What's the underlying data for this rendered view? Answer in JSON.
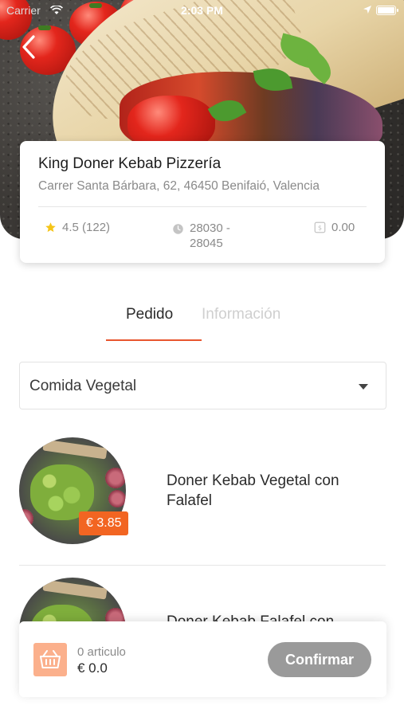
{
  "status_bar": {
    "carrier": "Carrier",
    "time": "2:03 PM"
  },
  "restaurant": {
    "name": "King Doner Kebab Pizzería",
    "address": "Carrer Santa Bárbara, 62, 46450 Benifaió, Valencia",
    "rating": "4.5 (122)",
    "postal_codes_line1": "28030 -",
    "postal_codes_line2": "28045",
    "delivery_fee": "0.00"
  },
  "tabs": [
    {
      "label": "Pedido",
      "active": true
    },
    {
      "label": "Información",
      "active": false
    }
  ],
  "category_select": {
    "selected": "Comida Vegetal"
  },
  "products": [
    {
      "name": "Doner Kebab Vegetal con Falafel",
      "price": "€ 3.85"
    },
    {
      "name": "Doner Kebab Falafel con"
    }
  ],
  "cart": {
    "count_label": "0 articulo",
    "total": "€ 0.0",
    "confirm_label": "Confirmar"
  },
  "colors": {
    "accent": "#f26522",
    "tab_underline": "#e8552e",
    "confirm_disabled": "#9a9a9a",
    "star": "#f5c518"
  },
  "icons": [
    "back-arrow-icon",
    "wifi-icon",
    "location-arrow-icon",
    "battery-icon",
    "star-icon",
    "clock-icon",
    "dollar-icon",
    "chevron-down-icon",
    "basket-icon"
  ]
}
